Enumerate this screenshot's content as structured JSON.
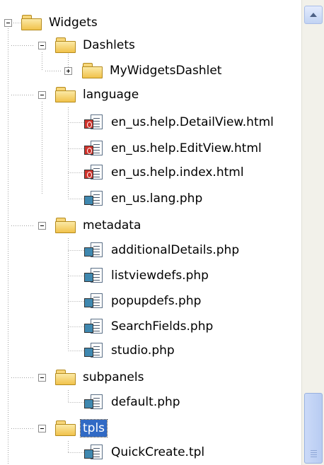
{
  "tree": [
    {
      "label": "Widgets",
      "type": "folder",
      "expanded": true,
      "icon": "folder-icon"
    },
    {
      "label": "Dashlets",
      "type": "folder",
      "expanded": true,
      "icon": "folder-icon"
    },
    {
      "label": "MyWidgetsDashlet",
      "type": "folder",
      "expanded": false,
      "icon": "folder-icon"
    },
    {
      "label": "language",
      "type": "folder",
      "expanded": true,
      "icon": "folder-icon"
    },
    {
      "label": "en_us.help.DetailView.html",
      "type": "file",
      "icon": "html-file-icon"
    },
    {
      "label": "en_us.help.EditView.html",
      "type": "file",
      "icon": "html-file-icon"
    },
    {
      "label": "en_us.help.index.html",
      "type": "file",
      "icon": "html-file-icon"
    },
    {
      "label": "en_us.lang.php",
      "type": "file",
      "icon": "php-file-icon"
    },
    {
      "label": "metadata",
      "type": "folder",
      "expanded": true,
      "icon": "folder-icon"
    },
    {
      "label": "additionalDetails.php",
      "type": "file",
      "icon": "php-file-icon"
    },
    {
      "label": "listviewdefs.php",
      "type": "file",
      "icon": "php-file-icon"
    },
    {
      "label": "popupdefs.php",
      "type": "file",
      "icon": "php-file-icon"
    },
    {
      "label": "SearchFields.php",
      "type": "file",
      "icon": "php-file-icon"
    },
    {
      "label": "studio.php",
      "type": "file",
      "icon": "php-file-icon"
    },
    {
      "label": "subpanels",
      "type": "folder",
      "expanded": true,
      "icon": "folder-icon"
    },
    {
      "label": "default.php",
      "type": "file",
      "icon": "php-file-icon"
    },
    {
      "label": "tpls",
      "type": "folder",
      "expanded": true,
      "selected": true,
      "icon": "folder-icon"
    },
    {
      "label": "QuickCreate.tpl",
      "type": "file",
      "icon": "php-file-icon"
    }
  ],
  "scrollbar": {
    "up_icon": "chevron-up-icon",
    "position": 0.86
  }
}
